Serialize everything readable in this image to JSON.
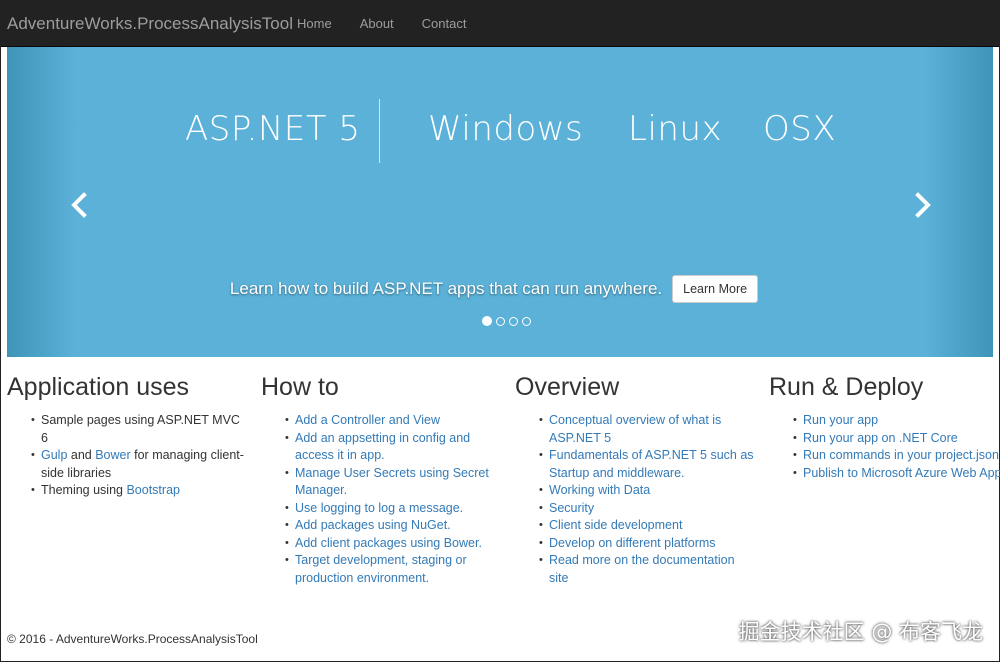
{
  "navbar": {
    "brand": "AdventureWorks.ProcessAnalysisTool",
    "links": [
      "Home",
      "About",
      "Contact"
    ]
  },
  "carousel": {
    "headline_words": [
      "ASP.NET 5",
      "Windows",
      "Linux",
      "OSX"
    ],
    "caption": "Learn how to build ASP.NET apps that can run anywhere.",
    "button_label": "Learn More",
    "indicator_count": 4,
    "active_index": 0,
    "colors": {
      "background": "#5bb1d8",
      "text": "#ffffff"
    }
  },
  "columns": [
    {
      "title": "Application uses",
      "items": [
        {
          "parts": [
            {
              "text": "Sample pages using ASP.NET MVC 6",
              "link": false
            }
          ]
        },
        {
          "parts": [
            {
              "text": "Gulp",
              "link": true
            },
            {
              "text": " and ",
              "link": false
            },
            {
              "text": "Bower",
              "link": true
            },
            {
              "text": " for managing client-side libraries",
              "link": false
            }
          ]
        },
        {
          "parts": [
            {
              "text": "Theming using ",
              "link": false
            },
            {
              "text": "Bootstrap",
              "link": true
            }
          ]
        }
      ]
    },
    {
      "title": "How to",
      "items": [
        {
          "parts": [
            {
              "text": "Add a Controller and View",
              "link": true
            }
          ]
        },
        {
          "parts": [
            {
              "text": "Add an appsetting in config and access it in app.",
              "link": true
            }
          ]
        },
        {
          "parts": [
            {
              "text": "Manage User Secrets using Secret Manager.",
              "link": true
            }
          ]
        },
        {
          "parts": [
            {
              "text": "Use logging to log a message.",
              "link": true
            }
          ]
        },
        {
          "parts": [
            {
              "text": "Add packages using NuGet.",
              "link": true
            }
          ]
        },
        {
          "parts": [
            {
              "text": "Add client packages using Bower.",
              "link": true
            }
          ]
        },
        {
          "parts": [
            {
              "text": "Target development, staging or production environment.",
              "link": true
            }
          ]
        }
      ]
    },
    {
      "title": "Overview",
      "items": [
        {
          "parts": [
            {
              "text": "Conceptual overview of what is ASP.NET 5",
              "link": true
            }
          ]
        },
        {
          "parts": [
            {
              "text": "Fundamentals of ASP.NET 5 such as Startup and middleware.",
              "link": true
            }
          ]
        },
        {
          "parts": [
            {
              "text": "Working with Data",
              "link": true
            }
          ]
        },
        {
          "parts": [
            {
              "text": "Security",
              "link": true
            }
          ]
        },
        {
          "parts": [
            {
              "text": "Client side development",
              "link": true
            }
          ]
        },
        {
          "parts": [
            {
              "text": "Develop on different platforms",
              "link": true
            }
          ]
        },
        {
          "parts": [
            {
              "text": "Read more on the documentation site",
              "link": true
            }
          ]
        }
      ]
    },
    {
      "title": "Run & Deploy",
      "items": [
        {
          "parts": [
            {
              "text": "Run your app",
              "link": true
            }
          ]
        },
        {
          "parts": [
            {
              "text": "Run your app on .NET Core",
              "link": true
            }
          ]
        },
        {
          "parts": [
            {
              "text": "Run commands in your project.json",
              "link": true
            }
          ]
        },
        {
          "parts": [
            {
              "text": "Publish to Microsoft Azure Web Apps",
              "link": true
            }
          ]
        }
      ]
    }
  ],
  "footer": {
    "text": "© 2016 - AdventureWorks.ProcessAnalysisTool"
  },
  "watermark": {
    "text": "掘金技术社区 @ 布客飞龙"
  },
  "colors": {
    "navbar": "#222222",
    "link": "#337ab7"
  }
}
